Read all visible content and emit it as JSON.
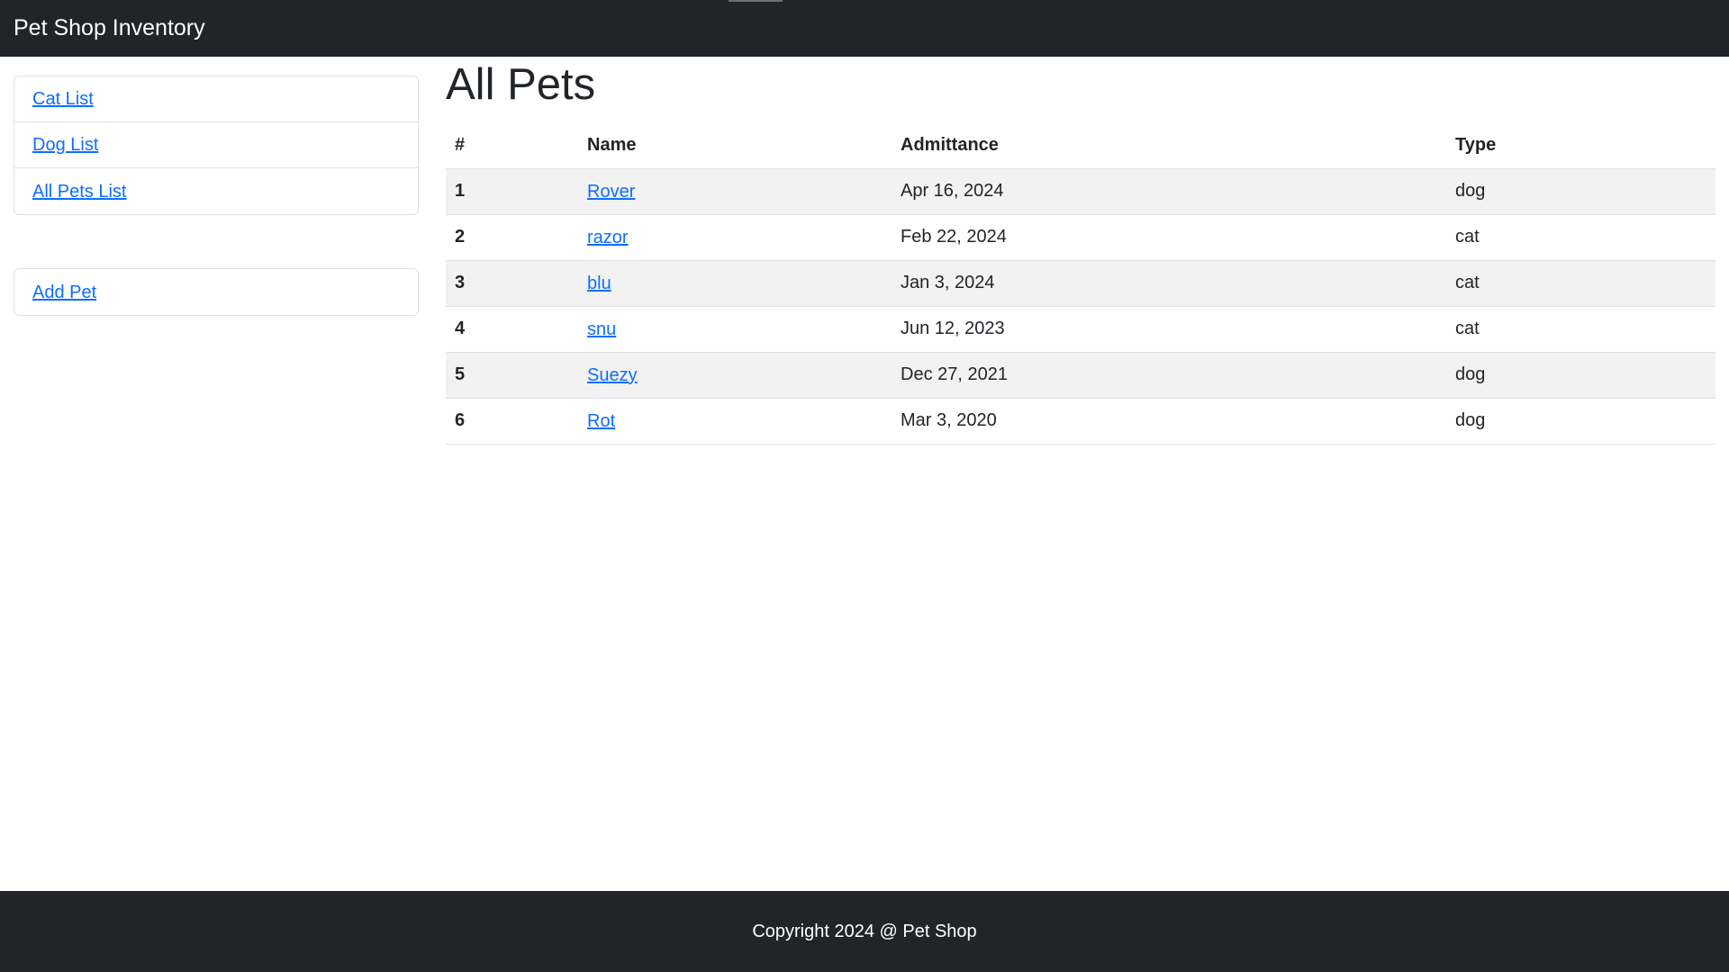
{
  "navbar": {
    "brand": "Pet Shop Inventory"
  },
  "sidebar": {
    "nav_items": [
      {
        "label": "Cat List"
      },
      {
        "label": "Dog List"
      },
      {
        "label": "All Pets List"
      }
    ],
    "actions": [
      {
        "label": "Add Pet"
      }
    ]
  },
  "main": {
    "title": "All Pets",
    "table": {
      "headers": [
        "#",
        "Name",
        "Admittance",
        "Type"
      ],
      "rows": [
        {
          "num": "1",
          "name": "Rover",
          "admittance": "Apr 16, 2024",
          "type": "dog"
        },
        {
          "num": "2",
          "name": "razor",
          "admittance": "Feb 22, 2024",
          "type": "cat"
        },
        {
          "num": "3",
          "name": "blu",
          "admittance": "Jan 3, 2024",
          "type": "cat"
        },
        {
          "num": "4",
          "name": "snu",
          "admittance": "Jun 12, 2023",
          "type": "cat"
        },
        {
          "num": "5",
          "name": "Suezy",
          "admittance": "Dec 27, 2021",
          "type": "dog"
        },
        {
          "num": "6",
          "name": "Rot",
          "admittance": "Mar 3, 2020",
          "type": "dog"
        }
      ]
    }
  },
  "footer": {
    "text": "Copyright 2024 @ Pet Shop"
  },
  "colors": {
    "navbar_bg": "#212529",
    "link": "#0d6efd",
    "stripe": "#f2f2f2",
    "border": "#dee2e6"
  }
}
